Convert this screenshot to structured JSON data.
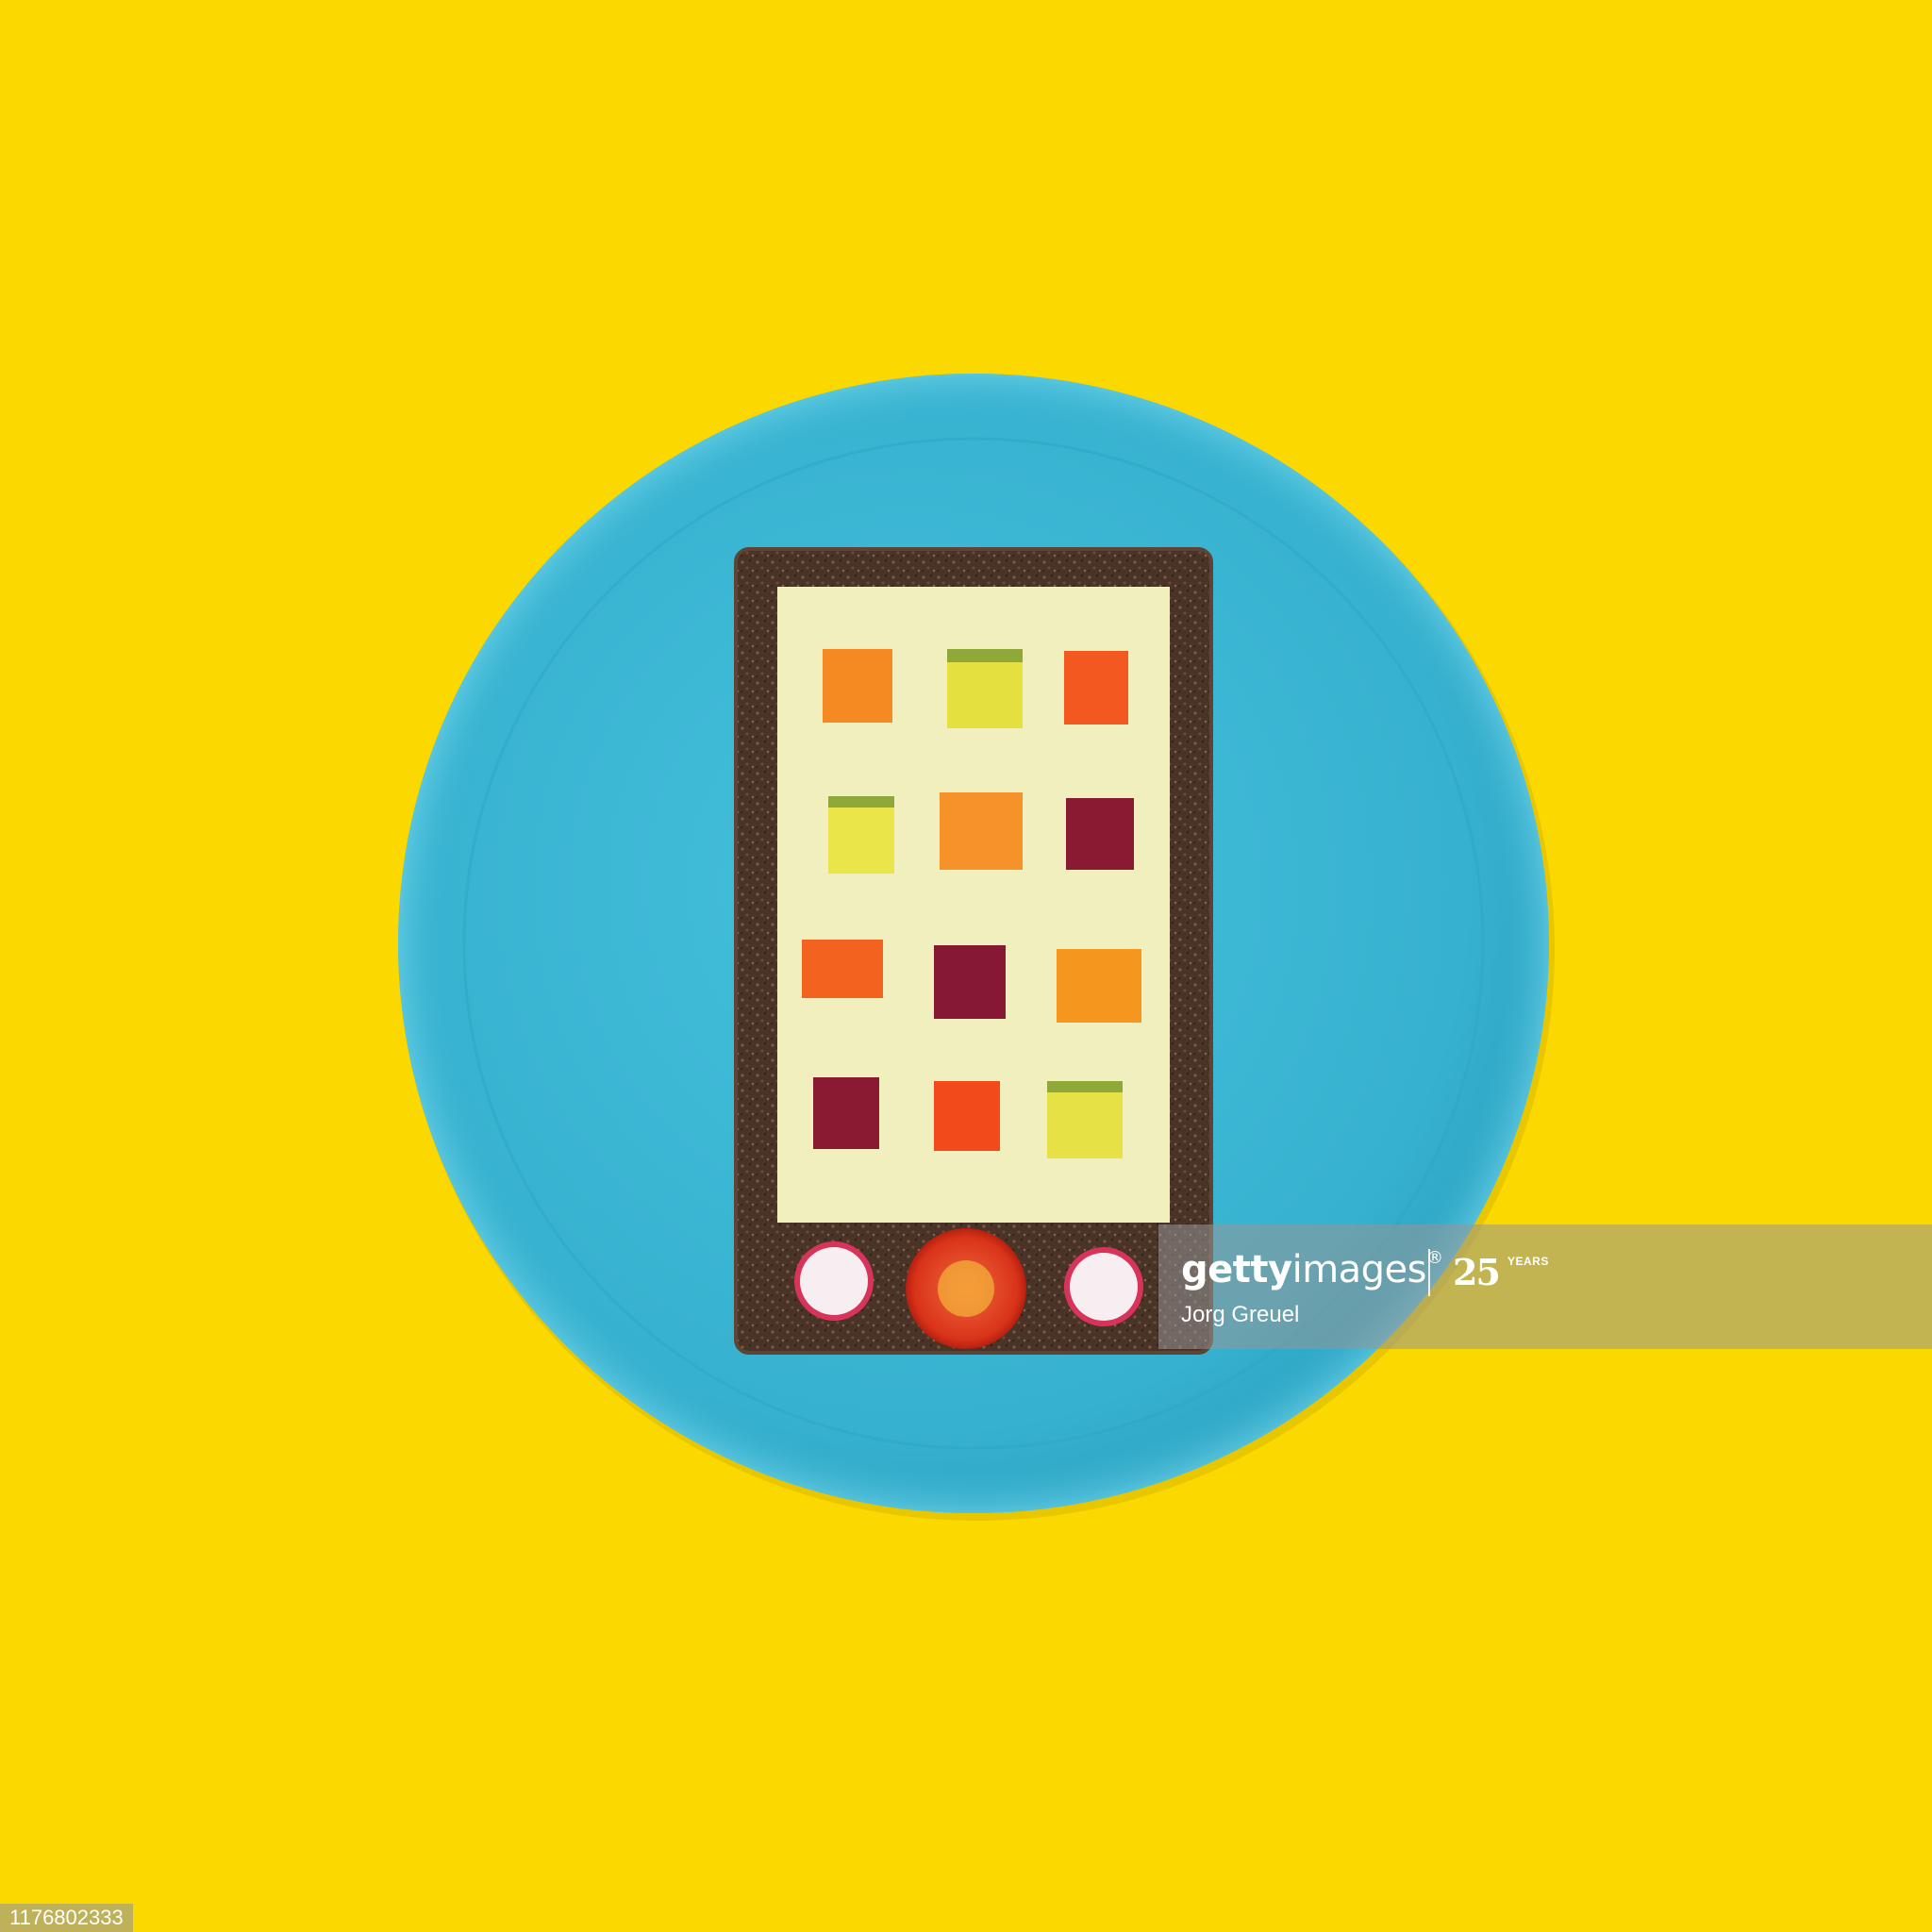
{
  "scene": {
    "background_color": "#fbd900",
    "plate_color": "#3fb9d6",
    "bread_color": "#4a3428",
    "cheese_color": "#f2efbf"
  },
  "watermark": {
    "brand_bold": "getty",
    "brand_regular": "images",
    "registered": "®",
    "years_number": "25",
    "years_label": "YEARS",
    "credit": "Jorg Greuel"
  },
  "image_id": "1176802333",
  "veg_grid": [
    [
      "carrot",
      "cucumber",
      "pepper"
    ],
    [
      "cucumber",
      "carrot",
      "beet"
    ],
    [
      "pepper",
      "beet",
      "carrot"
    ],
    [
      "beet",
      "pepper",
      "cucumber"
    ]
  ],
  "buttons": [
    "radish",
    "tomato",
    "radish"
  ]
}
